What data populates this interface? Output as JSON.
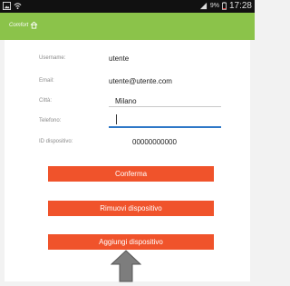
{
  "status_bar": {
    "battery_percent": "9%",
    "time": "17:28",
    "icons": [
      "gallery-icon",
      "wifi-icon",
      "signal-icon",
      "battery-icon"
    ]
  },
  "app_bar": {
    "brand": "Comfort"
  },
  "form": {
    "fields": [
      {
        "label": "Username:",
        "value": "utente"
      },
      {
        "label": "Email:",
        "value": "utente@utente.com"
      },
      {
        "label": "Città:",
        "value": "Milano"
      },
      {
        "label": "Telefono:",
        "value": ""
      },
      {
        "label": "ID dispositivo:",
        "value": "00000000000"
      }
    ]
  },
  "buttons": {
    "confirm": "Conferma",
    "remove_device": "Rimuovi dispositivo",
    "add_device": "Aggiungi dispositivo"
  },
  "colors": {
    "app_bar": "#8bc34a",
    "button": "#f0532b",
    "active_input": "#2e78c7",
    "pointer_arrow": "#7d7d7d"
  }
}
